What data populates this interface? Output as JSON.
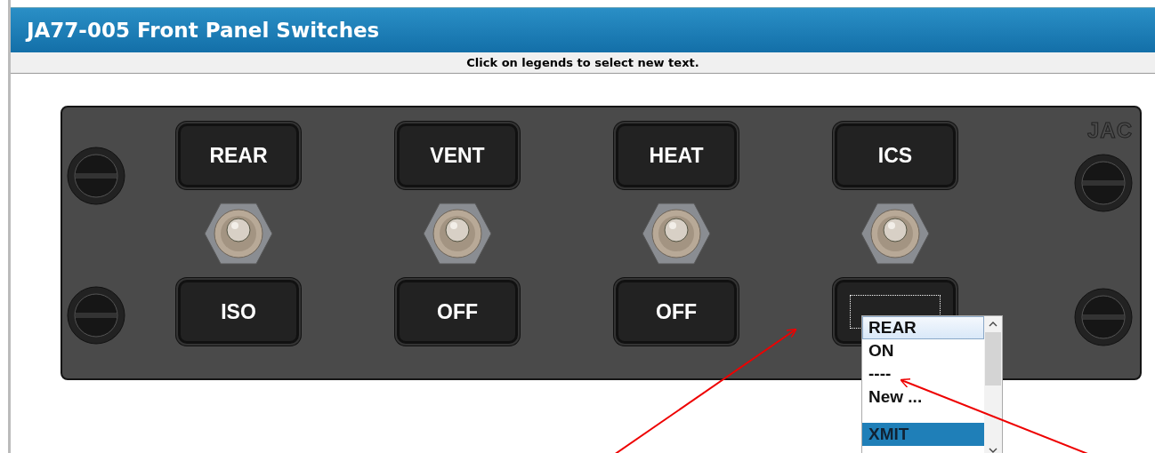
{
  "window": {
    "title": "JA77-005 Front Panel Switches"
  },
  "instruction": "Click on legends to select new text.",
  "logo": "JAC",
  "switches": [
    {
      "top": "REAR",
      "bottom": {
        "text": "ISO",
        "focused": false
      }
    },
    {
      "top": "VENT",
      "bottom": {
        "text": "OFF",
        "focused": false
      }
    },
    {
      "top": "HEAT",
      "bottom": {
        "text": "OFF",
        "focused": false
      }
    },
    {
      "top": "ICS",
      "bottom": {
        "focused": true
      }
    }
  ],
  "legend_list": {
    "items": [
      {
        "label": "REAR",
        "hovered": true,
        "selected": false
      },
      {
        "label": "ON",
        "hovered": false,
        "selected": false
      },
      {
        "label": "----",
        "hovered": false,
        "selected": false
      },
      {
        "label": "New ...",
        "hovered": false,
        "selected": false
      },
      {
        "label": "XMIT",
        "hovered": false,
        "selected": true
      }
    ]
  }
}
